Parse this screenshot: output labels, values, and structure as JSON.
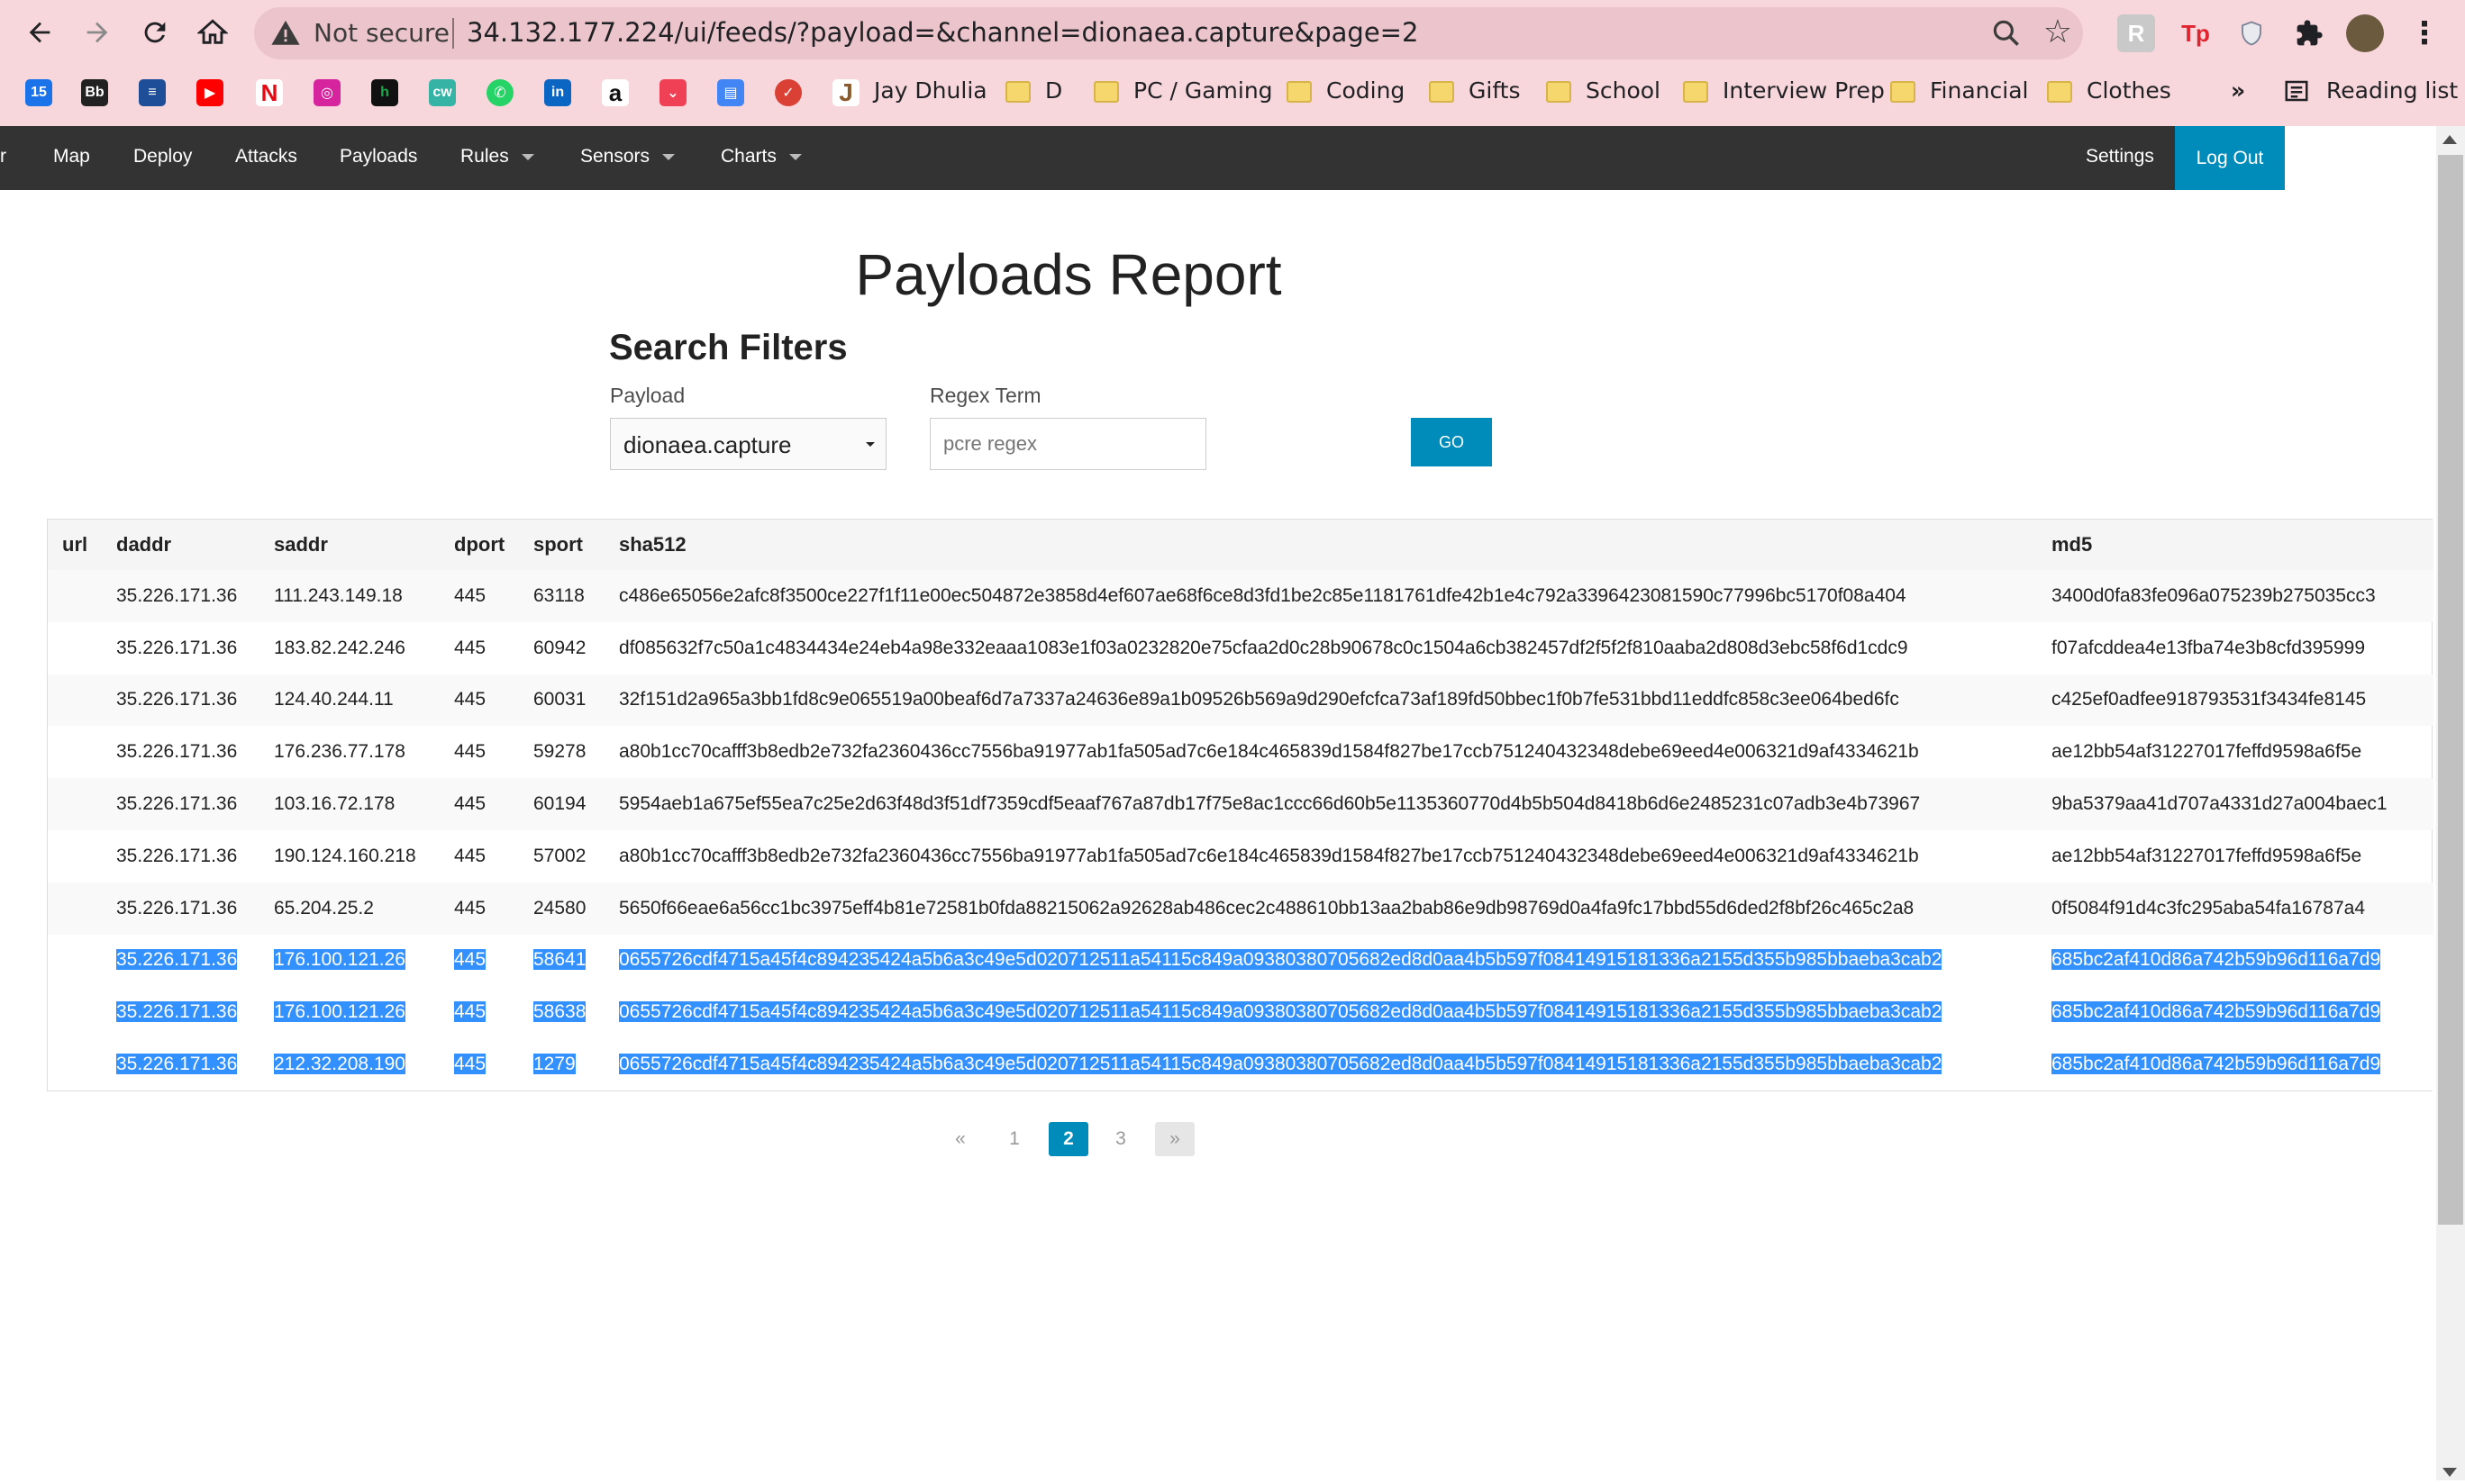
{
  "browser": {
    "security_text": "Not secure",
    "url": "34.132.177.224/ui/feeds/?payload=&channel=dionaea.capture&page=2",
    "bookmarks": [
      {
        "label": "Jay Dhulia"
      },
      {
        "label": "D"
      },
      {
        "label": "PC / Gaming"
      },
      {
        "label": "Coding"
      },
      {
        "label": "Gifts"
      },
      {
        "label": "School"
      },
      {
        "label": "Interview Prep"
      },
      {
        "label": "Financial"
      },
      {
        "label": "Clothes"
      }
    ],
    "overflow": "»",
    "reading_list": "Reading list"
  },
  "nav": {
    "brand_fragment": "r",
    "items": [
      "Map",
      "Deploy",
      "Attacks",
      "Payloads",
      "Rules",
      "Sensors",
      "Charts"
    ],
    "settings": "Settings",
    "logout": "Log Out"
  },
  "report": {
    "title": "Payloads Report",
    "filters_title": "Search Filters",
    "payload_label": "Payload",
    "payload_value": "dionaea.capture",
    "regex_label": "Regex Term",
    "regex_placeholder": "pcre regex",
    "go_label": "GO"
  },
  "table": {
    "headers": [
      "url",
      "daddr",
      "saddr",
      "dport",
      "sport",
      "sha512",
      "md5"
    ],
    "rows": [
      {
        "url": "",
        "daddr": "35.226.171.36",
        "saddr": "111.243.149.18",
        "dport": "445",
        "sport": "63118",
        "sha512": "c486e65056e2afc8f3500ce227f1f11e00ec504872e3858d4ef607ae68f6ce8d3fd1be2c85e1181761dfe42b1e4c792a3396423081590c77996bc5170f08a404",
        "md5": "3400d0fa83fe096a075239b275035cc3"
      },
      {
        "url": "",
        "daddr": "35.226.171.36",
        "saddr": "183.82.242.246",
        "dport": "445",
        "sport": "60942",
        "sha512": "df085632f7c50a1c4834434e24eb4a98e332eaaa1083e1f03a0232820e75cfaa2d0c28b90678c0c1504a6cb382457df2f5f2f810aaba2d808d3ebc58f6d1cdc9",
        "md5": "f07afcddea4e13fba74e3b8cfd395999"
      },
      {
        "url": "",
        "daddr": "35.226.171.36",
        "saddr": "124.40.244.11",
        "dport": "445",
        "sport": "60031",
        "sha512": "32f151d2a965a3bb1fd8c9e065519a00beaf6d7a7337a24636e89a1b09526b569a9d290efcfca73af189fd50bbec1f0b7fe531bbd11eddfc858c3ee064bed6fc",
        "md5": "c425ef0adfee918793531f3434fe8145"
      },
      {
        "url": "",
        "daddr": "35.226.171.36",
        "saddr": "176.236.77.178",
        "dport": "445",
        "sport": "59278",
        "sha512": "a80b1cc70cafff3b8edb2e732fa2360436cc7556ba91977ab1fa505ad7c6e184c465839d1584f827be17ccb751240432348debe69eed4e006321d9af4334621b",
        "md5": "ae12bb54af31227017feffd9598a6f5e"
      },
      {
        "url": "",
        "daddr": "35.226.171.36",
        "saddr": "103.16.72.178",
        "dport": "445",
        "sport": "60194",
        "sha512": "5954aeb1a675ef55ea7c25e2d63f48d3f51df7359cdf5eaaf767a87db17f75e8ac1ccc66d60b5e1135360770d4b5b504d8418b6d6e2485231c07adb3e4b73967",
        "md5": "9ba5379aa41d707a4331d27a004baec1"
      },
      {
        "url": "",
        "daddr": "35.226.171.36",
        "saddr": "190.124.160.218",
        "dport": "445",
        "sport": "57002",
        "sha512": "a80b1cc70cafff3b8edb2e732fa2360436cc7556ba91977ab1fa505ad7c6e184c465839d1584f827be17ccb751240432348debe69eed4e006321d9af4334621b",
        "md5": "ae12bb54af31227017feffd9598a6f5e"
      },
      {
        "url": "",
        "daddr": "35.226.171.36",
        "saddr": "65.204.25.2",
        "dport": "445",
        "sport": "24580",
        "sha512": "5650f66eae6a56cc1bc3975eff4b81e72581b0fda88215062a92628ab486cec2c488610bb13aa2bab86e9db98769d0a4fa9fc17bbd55d6ded2f8bf26c465c2a8",
        "md5": "0f5084f91d4c3fc295aba54fa16787a4"
      },
      {
        "url": "",
        "daddr": "35.226.171.36",
        "saddr": "176.100.121.26",
        "dport": "445",
        "sport": "58641",
        "sha512": "0655726cdf4715a45f4c894235424a5b6a3c49e5d020712511a54115c849a09380380705682ed8d0aa4b5b597f08414915181336a2155d355b985bbaeba3cab2",
        "md5": "685bc2af410d86a742b59b96d116a7d9"
      },
      {
        "url": "",
        "daddr": "35.226.171.36",
        "saddr": "176.100.121.26",
        "dport": "445",
        "sport": "58638",
        "sha512": "0655726cdf4715a45f4c894235424a5b6a3c49e5d020712511a54115c849a09380380705682ed8d0aa4b5b597f08414915181336a2155d355b985bbaeba3cab2",
        "md5": "685bc2af410d86a742b59b96d116a7d9"
      },
      {
        "url": "",
        "daddr": "35.226.171.36",
        "saddr": "212.32.208.190",
        "dport": "445",
        "sport": "1279",
        "sha512": "0655726cdf4715a45f4c894235424a5b6a3c49e5d020712511a54115c849a09380380705682ed8d0aa4b5b597f08414915181336a2155d355b985bbaeba3cab2",
        "md5": "685bc2af410d86a742b59b96d116a7d9"
      }
    ],
    "selected_rows": [
      7,
      8,
      9
    ]
  },
  "pagination": {
    "prev": "«",
    "pages": [
      "1",
      "2",
      "3"
    ],
    "current": "2",
    "next": "»"
  },
  "colors": {
    "chrome_bg": "#f8d7dc",
    "navbar_bg": "#333333",
    "accent": "#008cba",
    "selection": "#3390ff"
  }
}
